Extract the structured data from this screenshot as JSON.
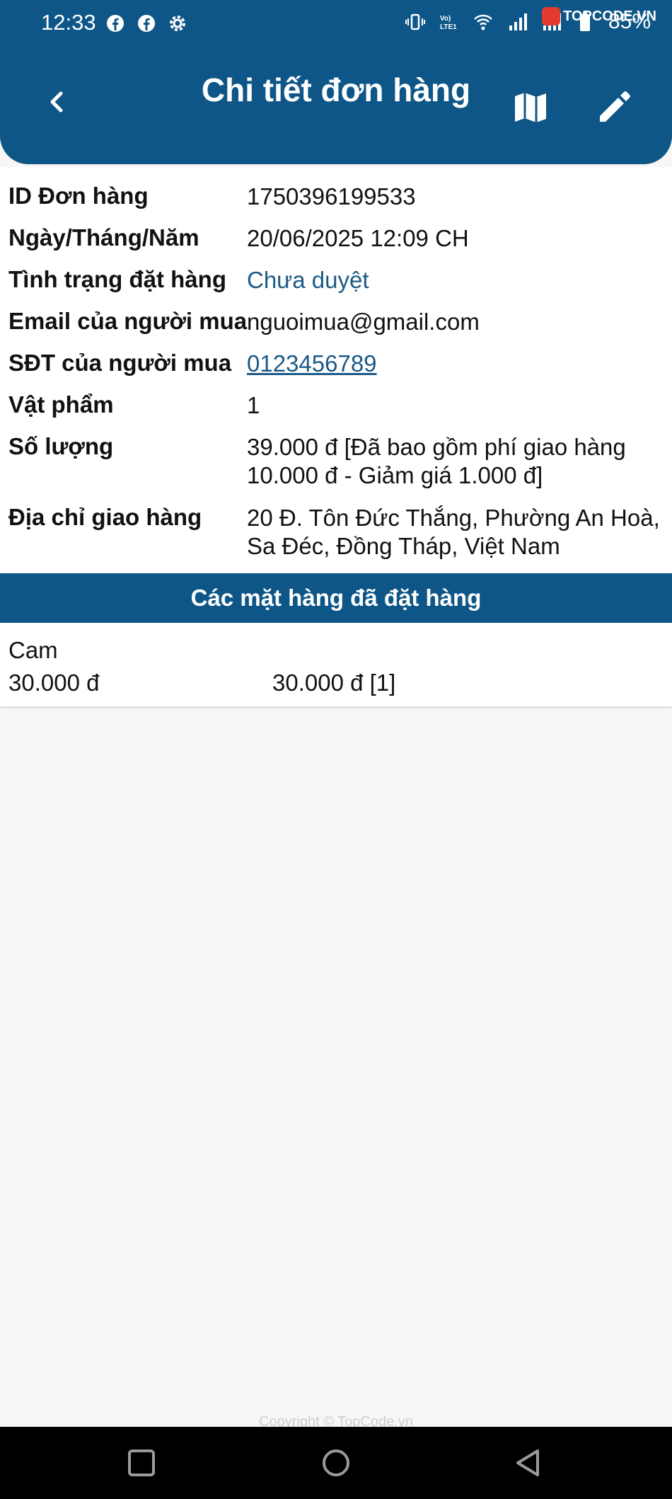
{
  "status_bar": {
    "time": "12:33",
    "battery": "85%",
    "icons_left": [
      "facebook-icon",
      "facebook-icon",
      "settings-gear-icon"
    ],
    "icons_right": [
      "vibrate-icon",
      "volte-lte1-icon",
      "wifi-icon",
      "signal-icon",
      "signal-icon",
      "battery-icon"
    ],
    "watermark": "TOPCODE.VN"
  },
  "header": {
    "title": "Chi tiết đơn hàng",
    "background": "#0e5687"
  },
  "details": {
    "order_id": {
      "label": "ID Đơn hàng",
      "value": "1750396199533"
    },
    "date": {
      "label": "Ngày/Tháng/Năm",
      "value": "20/06/2025 12:09 CH"
    },
    "status": {
      "label": "Tình trạng đặt hàng",
      "value": "Chưa duyệt"
    },
    "email": {
      "label": "Email của người mua",
      "value": "nguoimua@gmail.com"
    },
    "phone": {
      "label": "SĐT của người mua",
      "value": "0123456789"
    },
    "items_count": {
      "label": "Vật phẩm",
      "value": "1"
    },
    "amount": {
      "label": "Số lượng",
      "value": "39.000 đ [Đã bao gồm phí giao hàng 10.000 đ - Giảm giá 1.000 đ]"
    },
    "address": {
      "label": "Địa chỉ giao hàng",
      "value": "20 Đ. Tôn Đức Thắng, Phường An Hoà, Sa Đéc, Đồng Tháp, Việt Nam"
    }
  },
  "ordered_items": {
    "heading": "Các mặt hàng đã đặt hàng",
    "items": [
      {
        "name": "Cam",
        "unit_price": "30.000 đ",
        "total": "30.000 đ [1]"
      }
    ]
  },
  "footer": {
    "copyright": "Copyright © TopCode.vn"
  }
}
